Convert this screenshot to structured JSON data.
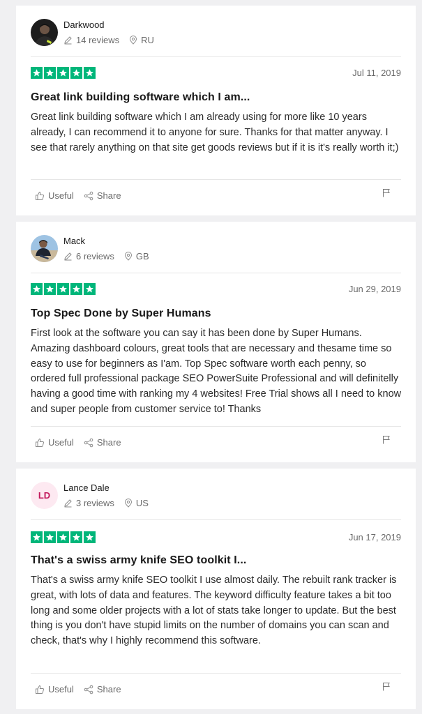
{
  "reviews": [
    {
      "name": "Darkwood",
      "avatar_type": "photo",
      "review_count": "14 reviews",
      "country": "RU",
      "rating": 5,
      "date": "Jul 11, 2019",
      "title": "Great link building software which I am...",
      "body": "Great link building software which I am already using for more like 10 years already, I can recommend it to anyone for sure. Thanks for that matter anyway. I see that rarely anything on that site get goods reviews but if it is it's really worth it;)",
      "useful_label": "Useful",
      "share_label": "Share"
    },
    {
      "name": "Mack",
      "avatar_type": "photo",
      "review_count": "6 reviews",
      "country": "GB",
      "rating": 5,
      "date": "Jun 29, 2019",
      "title": "Top Spec Done by Super Humans",
      "body": "First look at the software you can say it has been done by Super Humans. Amazing dashboard colours, great tools that are necessary and thesame time so easy to use for beginners as I'am. Top Spec software worth each penny, so ordered full professional package SEO PowerSuite Professional and will definitelly having a good time with ranking my 4 websites! Free Trial shows all I need to know and super people from customer service to! Thanks",
      "useful_label": "Useful",
      "share_label": "Share"
    },
    {
      "name": "Lance Dale",
      "avatar_type": "initials",
      "initials": "LD",
      "review_count": "3 reviews",
      "country": "US",
      "rating": 5,
      "date": "Jun 17, 2019",
      "title": "That's a swiss army knife SEO toolkit I...",
      "body": "That's a swiss army knife SEO toolkit I use almost daily. The rebuilt rank tracker is great, with lots of data and features. The keyword difficulty feature takes a bit too long and some older projects with a lot of stats take longer to update. But the best thing is you don't have stupid limits on the number of domains you can scan and check, that's why I highly recommend this software.",
      "useful_label": "Useful",
      "share_label": "Share"
    }
  ],
  "colors": {
    "star_green": "#00b67a",
    "background": "#f0f0f2",
    "initials_bg": "#fde9f1",
    "initials_fg": "#c2185b"
  },
  "icons": {
    "reviews": "pencil-icon",
    "country": "location-pin-icon",
    "useful": "thumbs-up-icon",
    "share": "share-icon",
    "report": "flag-icon",
    "star": "star-icon"
  }
}
